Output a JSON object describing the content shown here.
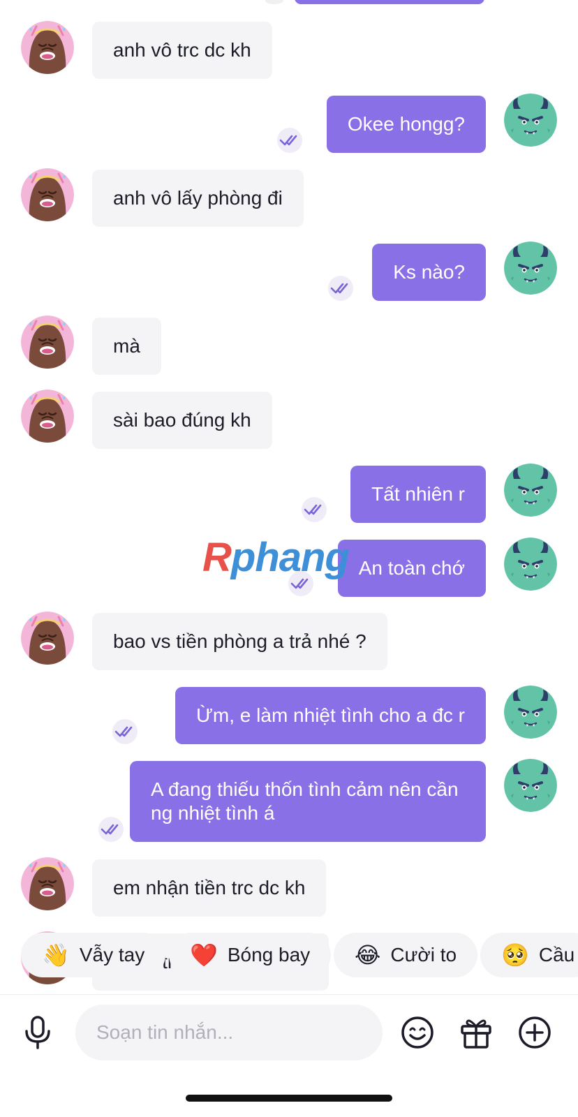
{
  "conversation": {
    "messages": [
      {
        "side": "in",
        "text": "anh vô trc dc kh"
      },
      {
        "side": "out",
        "text": "Okee hongg?"
      },
      {
        "side": "in",
        "text": "anh vô lấy phòng đi"
      },
      {
        "side": "out",
        "text": "Ks nào?"
      },
      {
        "side": "in",
        "text": "mà"
      },
      {
        "side": "in",
        "text": "sài bao đúng kh"
      },
      {
        "side": "out",
        "text": "Tất nhiên r"
      },
      {
        "side": "out",
        "text": "An toàn chớ"
      },
      {
        "side": "in",
        "text": "bao vs tiền phòng a trả nhé ?"
      },
      {
        "side": "out",
        "text": "Ừm, e làm nhiệt tình cho a đc r"
      },
      {
        "side": "out",
        "text": "A đang thiếu thốn tình cảm nên cần ng nhiệt tình á"
      },
      {
        "side": "in",
        "text": "em nhận tiền trc dc kh"
      },
      {
        "side": "in",
        "text": "nhận trc khi vào việc á"
      }
    ]
  },
  "watermark": {
    "first": "R",
    "rest": "phang"
  },
  "quick_reactions": [
    {
      "emoji": "👋",
      "label": "Vẫy tay"
    },
    {
      "emoji": "❤️",
      "label": "Bóng bay"
    },
    {
      "emoji": "😂",
      "label": "Cười to"
    },
    {
      "emoji": "🥺",
      "label": "Cầu"
    }
  ],
  "composer": {
    "placeholder": "Soạn tin nhắn...",
    "icons": [
      "microphone-icon",
      "sticker-smile-icon",
      "gift-icon",
      "add-circle-icon"
    ]
  },
  "colors": {
    "outgoing_bubble": "#8a70e6",
    "incoming_bubble": "#f4f4f6",
    "accent": "#8a70e6"
  }
}
